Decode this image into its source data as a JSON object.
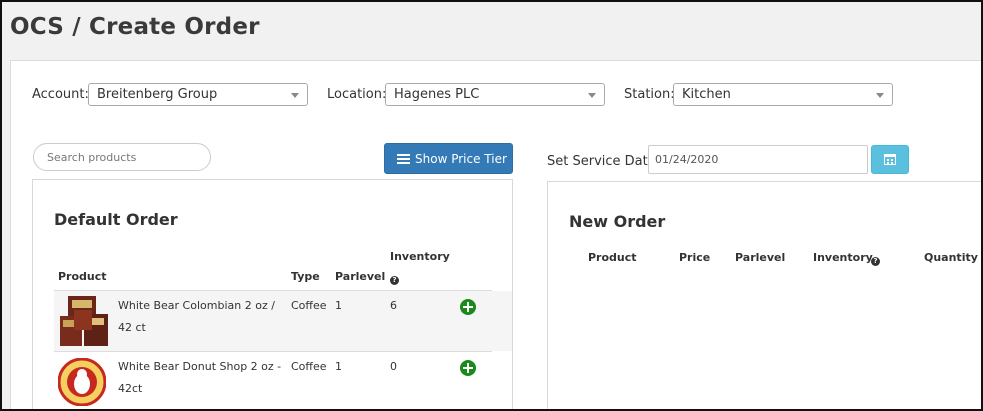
{
  "page": {
    "title": "OCS / Create Order"
  },
  "filters": {
    "account_label": "Account:",
    "account_value": "Breitenberg Group",
    "location_label": "Location:",
    "location_value": "Hagenes PLC",
    "station_label": "Station:",
    "station_value": "Kitchen"
  },
  "search": {
    "placeholder": "Search products"
  },
  "toolbar": {
    "price_tier_label": "Show Price Tier"
  },
  "service_date": {
    "label": "Set Service Date",
    "value": "01/24/2020"
  },
  "default_order": {
    "title": "Default Order",
    "columns": {
      "product": "Product",
      "type": "Type",
      "parlevel": "Parlevel",
      "inventory": "Inventory"
    },
    "rows": [
      {
        "name": "White Bear Colombian 2 oz / 42 ct",
        "type": "Coffee",
        "parlevel": "1",
        "inventory": "6"
      },
      {
        "name": "White Bear Donut Shop 2 oz - 42ct",
        "type": "Coffee",
        "parlevel": "1",
        "inventory": "0"
      }
    ]
  },
  "new_order": {
    "title": "New Order",
    "columns": {
      "product": "Product",
      "price": "Price",
      "parlevel": "Parlevel",
      "inventory": "Inventory",
      "quantity": "Quantity"
    }
  },
  "colors": {
    "primary_button": "#337ab7",
    "info_button": "#5bc0de",
    "add_icon": "#1a8a1a"
  },
  "icons": [
    "list-icon",
    "calendar-icon",
    "help-icon",
    "add-icon",
    "caret-down-icon"
  ]
}
